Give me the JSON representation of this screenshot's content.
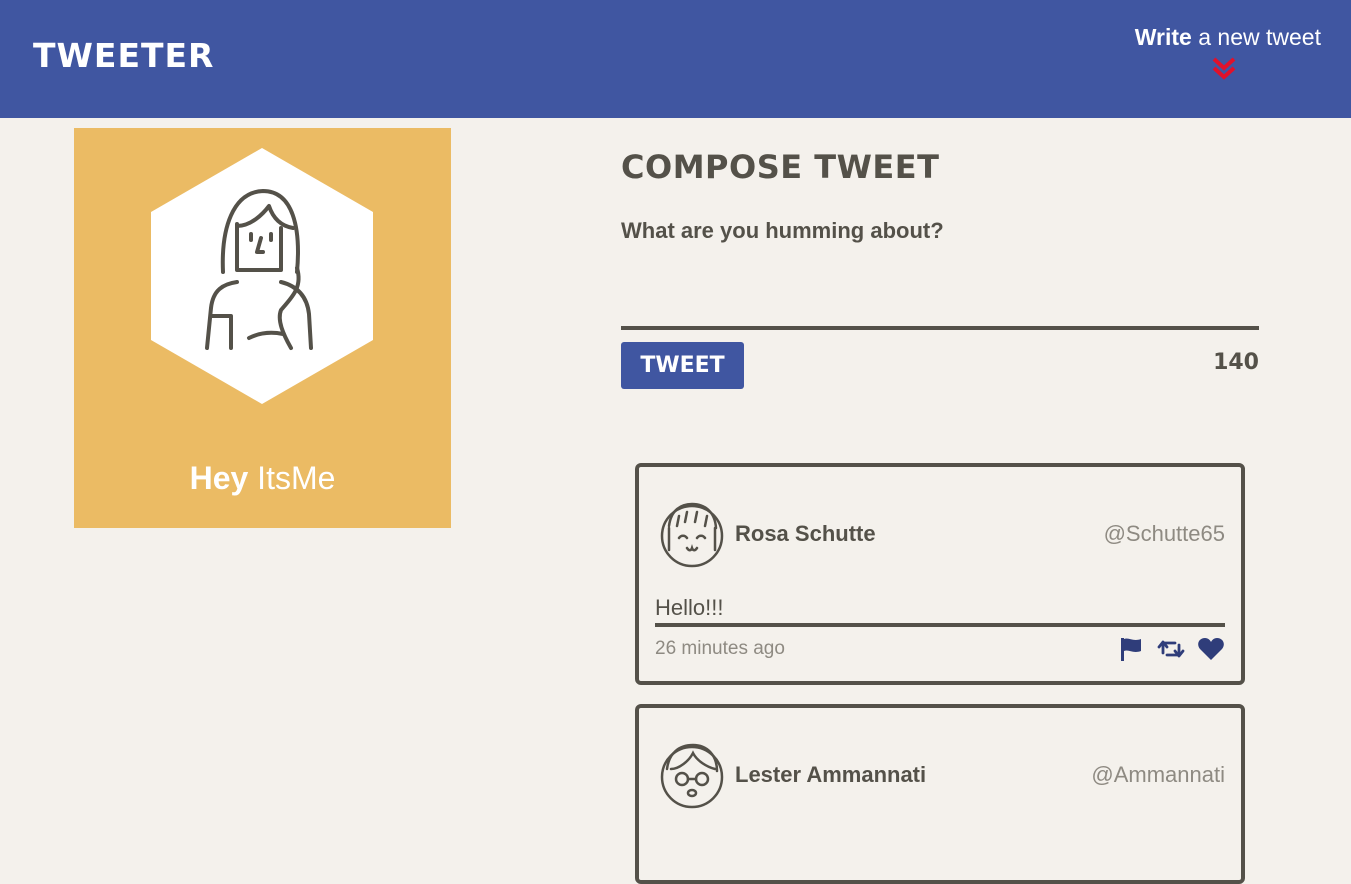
{
  "nav": {
    "brand": "Tweeter",
    "compose_strong": "Write",
    "compose_light": "a new tweet",
    "chevron_color": "#e0112b"
  },
  "profile": {
    "greeting_strong": "Hey",
    "greeting_light": "ItsMe",
    "background_color": "#ebbb64"
  },
  "compose": {
    "title": "Compose Tweet",
    "placeholder": "What are you humming about?",
    "button_label": "Tweet",
    "counter": "140"
  },
  "tweets": [
    {
      "author": "Rosa Schutte",
      "handle": "@Schutte65",
      "content": "Hello!!!",
      "timestamp": "26 minutes ago",
      "actions": [
        "flag-icon",
        "retweet-icon",
        "heart-icon"
      ]
    },
    {
      "author": "Lester Ammannati",
      "handle": "@Ammannati"
    }
  ],
  "colors": {
    "primary": "#4056a1",
    "accent": "#e0112b",
    "text": "#545149",
    "muted": "#8e8a82",
    "background": "#f4f1ec"
  }
}
